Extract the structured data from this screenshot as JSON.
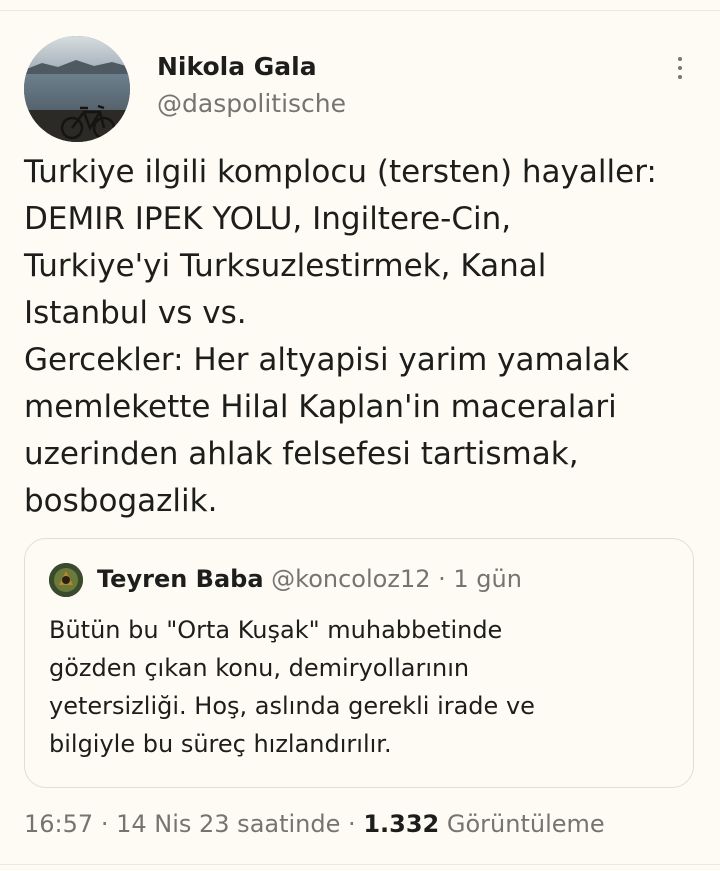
{
  "author": {
    "name": "Nikola Gala",
    "handle": "@daspolitische"
  },
  "tweet": {
    "lines": [
      "Turkiye ilgili komplocu (tersten) hayaller:",
      "DEMIR IPEK YOLU, Ingiltere-Cin,",
      "Turkiye'yi Turksuzlestirmek, Kanal",
      "Istanbul vs vs.",
      "Gercekler: Her altyapisi yarim yamalak",
      "memlekette Hilal Kaplan'in maceralari",
      "uzerinden ahlak felsefesi tartismak,",
      "bosbogazlik."
    ]
  },
  "quote": {
    "name": "Teyren Baba",
    "handle": "@koncoloz12",
    "separator": "·",
    "time": "1 gün",
    "lines": [
      "Bütün bu \"Orta Kuşak\" muhabbetinde",
      "gözden çıkan konu, demiryollarının",
      "yetersizliği. Hoş, aslında gerekli irade ve",
      "bilgiyle bu süreç hızlandırılır."
    ]
  },
  "meta": {
    "time": "16:57",
    "separator": "·",
    "date": "14 Nis 23 saatinde",
    "views_count": "1.332",
    "views_label": "Görüntüleme"
  },
  "colors": {
    "background": "#fdfbf3",
    "text": "#1d1d1b",
    "secondary": "#777470",
    "border": "#e2ded5"
  },
  "icons": {
    "more": "more-vertical-icon"
  }
}
